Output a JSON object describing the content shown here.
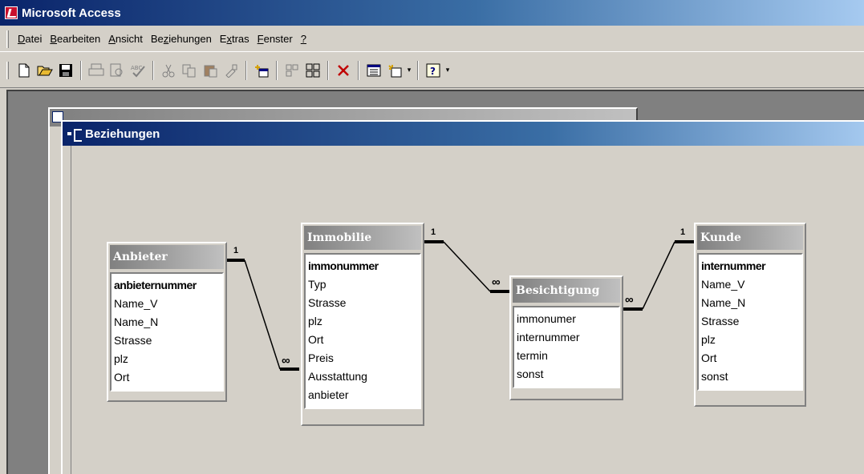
{
  "app": {
    "title": "Microsoft Access"
  },
  "menu": {
    "items": [
      {
        "mnemonic": "D",
        "rest": "atei"
      },
      {
        "mnemonic": "B",
        "rest": "earbeiten"
      },
      {
        "mnemonic": "A",
        "rest": "nsicht"
      },
      {
        "pre": "Be",
        "mnemonic": "z",
        "rest": "iehungen"
      },
      {
        "pre": "E",
        "mnemonic": "x",
        "rest": "tras"
      },
      {
        "mnemonic": "F",
        "rest": "enster"
      },
      {
        "mnemonic": "?",
        "rest": ""
      }
    ]
  },
  "toolbar": {
    "buttons": [
      "new-icon",
      "open-icon",
      "save-icon",
      "print-icon",
      "print-preview-icon",
      "spelling-icon",
      "cut-icon",
      "copy-icon",
      "paste-icon",
      "format-painter-icon",
      "show-table-icon",
      "show-direct-icon",
      "show-all-icon",
      "delete-icon",
      "database-window-icon",
      "new-object-icon",
      "help-icon"
    ]
  },
  "window": {
    "title": "Beziehungen"
  },
  "tables": {
    "anbieter": {
      "title": "Anbieter",
      "fields": [
        "anbieternummer",
        "Name_V",
        "Name_N",
        "Strasse",
        "plz",
        "Ort"
      ]
    },
    "immobilie": {
      "title": "Immobilie",
      "fields": [
        "immonummer",
        "Typ",
        "Strasse",
        "plz",
        "Ort",
        "Preis",
        "Ausstattung",
        "anbieter"
      ]
    },
    "besichtigung": {
      "title": "Besichtigung",
      "fields": [
        "immonumer",
        "internummer",
        "termin",
        "sonst"
      ]
    },
    "kunde": {
      "title": "Kunde",
      "fields": [
        "internummer",
        "Name_V",
        "Name_N",
        "Strasse",
        "plz",
        "Ort",
        "sonst"
      ]
    }
  },
  "relations": {
    "one": "1",
    "many": "∞"
  }
}
